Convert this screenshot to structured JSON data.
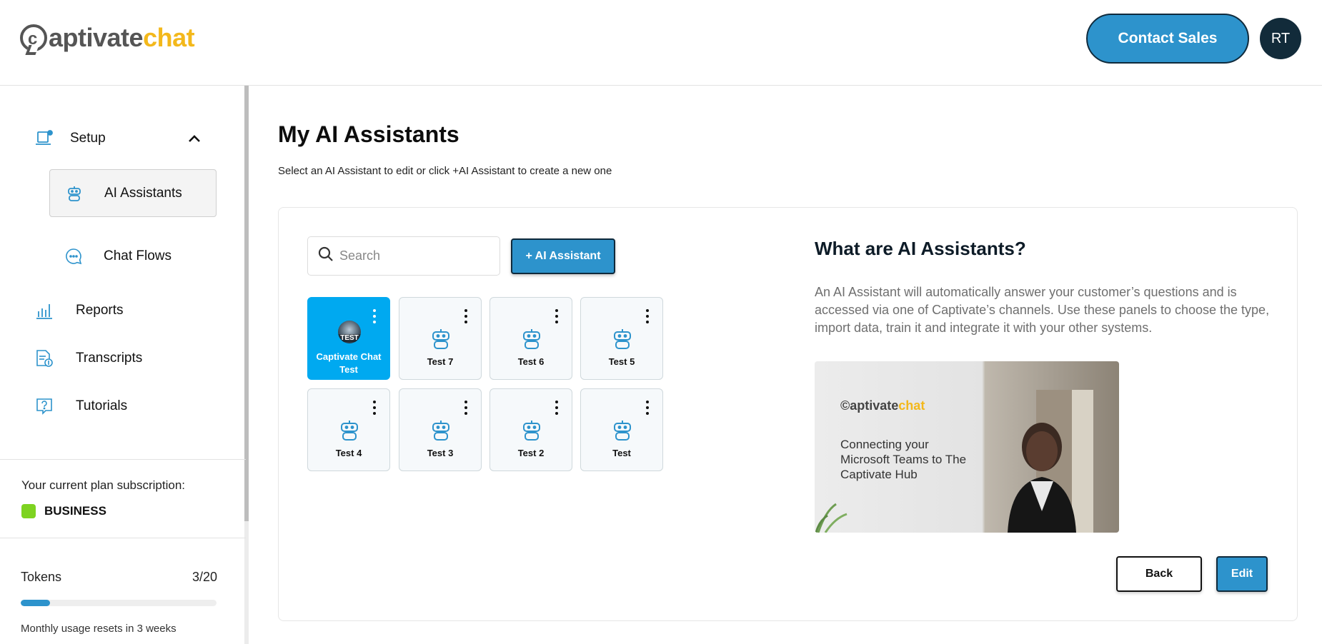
{
  "brand": {
    "logo_mark": "c",
    "logo_dark": "aptivate",
    "logo_accent": "chat",
    "accent_color": "#f3b81b",
    "primary_color": "#2d93cc"
  },
  "header": {
    "contact_label": "Contact Sales",
    "avatar_initials": "RT"
  },
  "sidebar": {
    "setup_label": "Setup",
    "sub_items": [
      {
        "label": "AI Assistants",
        "icon": "robot-icon",
        "active": true
      },
      {
        "label": "Chat Flows",
        "icon": "chat-bubble-icon",
        "active": false
      }
    ],
    "items": [
      {
        "label": "Reports",
        "icon": "bar-chart-icon"
      },
      {
        "label": "Transcripts",
        "icon": "document-icon"
      },
      {
        "label": "Tutorials",
        "icon": "question-icon"
      }
    ],
    "plan": {
      "label": "Your current plan subscription:",
      "name": "BUSINESS",
      "color": "#7ed321"
    },
    "tokens": {
      "label": "Tokens",
      "count": "3/20",
      "used": 3,
      "total": 20,
      "note": "Monthly usage resets in 3 weeks"
    }
  },
  "main": {
    "title": "My AI Assistants",
    "subtitle": "Select an AI Assistant to edit or click +AI Assistant to create a new one",
    "search_placeholder": "Search",
    "add_label": "+ AI Assistant",
    "assistants": [
      {
        "name": "Captivate Chat Test",
        "selected": true,
        "thumb_text": "TEST"
      },
      {
        "name": "Test 7",
        "selected": false
      },
      {
        "name": "Test 6",
        "selected": false
      },
      {
        "name": "Test 5",
        "selected": false
      },
      {
        "name": "Test 4",
        "selected": false
      },
      {
        "name": "Test 3",
        "selected": false
      },
      {
        "name": "Test 2",
        "selected": false
      },
      {
        "name": "Test",
        "selected": false
      }
    ],
    "info": {
      "title": "What are AI Assistants?",
      "text": "An AI Assistant will automatically answer your customer’s questions and is accessed via one of Captivate’s channels. Use these panels to choose the type, import data, train it and integrate it with your other systems.",
      "video_logo_dark": "aptivate",
      "video_logo_accent": "chat",
      "video_caption": "Connecting your Microsoft Teams to The Captivate Hub"
    },
    "back_label": "Back",
    "edit_label": "Edit"
  }
}
